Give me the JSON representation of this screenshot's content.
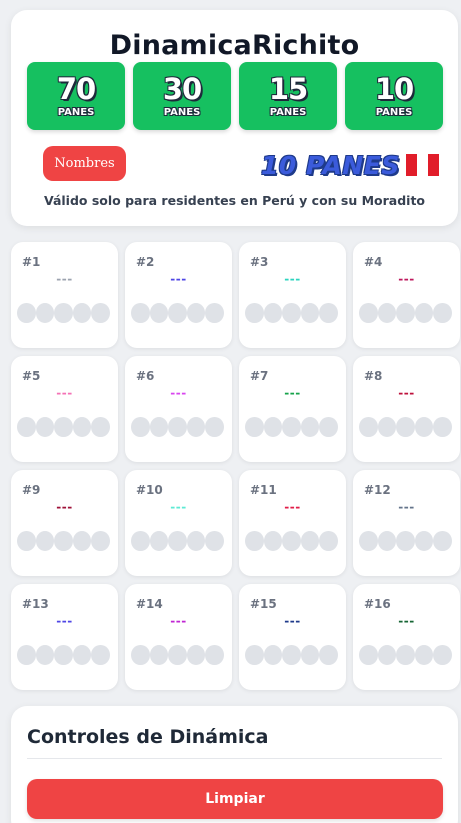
{
  "header": {
    "title": "DinamicaRichito",
    "packs": [
      {
        "number": "70",
        "unit": "PANES"
      },
      {
        "number": "30",
        "unit": "PANES"
      },
      {
        "number": "15",
        "unit": "PANES"
      },
      {
        "number": "10",
        "unit": "PANES"
      }
    ],
    "nombres_label": "Nombres",
    "selected_pack": "10 PANES",
    "disclaimer": "Válido solo para residentes en Perú y con su Moradito"
  },
  "grid": {
    "cells": [
      {
        "label": "#1",
        "value": "---",
        "color": "#9ca3af"
      },
      {
        "label": "#2",
        "value": "---",
        "color": "#4f46e5"
      },
      {
        "label": "#3",
        "value": "---",
        "color": "#2dd4bf"
      },
      {
        "label": "#4",
        "value": "---",
        "color": "#be185d"
      },
      {
        "label": "#5",
        "value": "---",
        "color": "#f472b6"
      },
      {
        "label": "#6",
        "value": "---",
        "color": "#d946ef"
      },
      {
        "label": "#7",
        "value": "---",
        "color": "#16a34a"
      },
      {
        "label": "#8",
        "value": "---",
        "color": "#be123c"
      },
      {
        "label": "#9",
        "value": "---",
        "color": "#9f1239"
      },
      {
        "label": "#10",
        "value": "---",
        "color": "#5eead4"
      },
      {
        "label": "#11",
        "value": "---",
        "color": "#e11d48"
      },
      {
        "label": "#12",
        "value": "---",
        "color": "#64748b"
      },
      {
        "label": "#13",
        "value": "---",
        "color": "#4f46e5"
      },
      {
        "label": "#14",
        "value": "---",
        "color": "#c026d3"
      },
      {
        "label": "#15",
        "value": "---",
        "color": "#1e3a8a"
      },
      {
        "label": "#16",
        "value": "---",
        "color": "#166534"
      }
    ]
  },
  "controls": {
    "title": "Controles de Dinámica",
    "clear_label": "Limpiar"
  },
  "colors": {
    "pack_green": "#16c060",
    "accent_red": "#ef4444",
    "selected_blue": "#3b5bdb"
  }
}
